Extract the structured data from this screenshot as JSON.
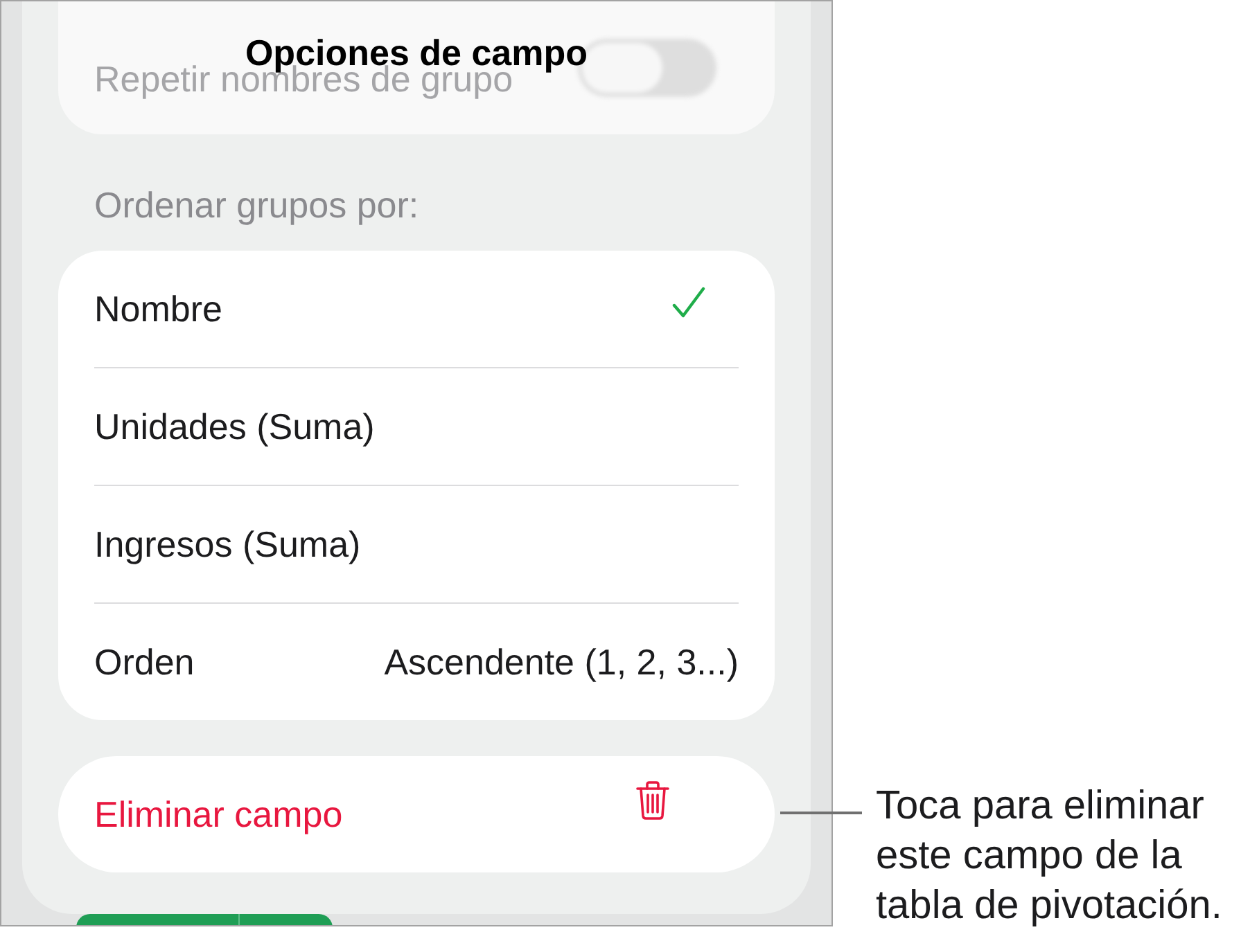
{
  "sheet": {
    "title": "Opciones de campo"
  },
  "background_row": {
    "label": "Repetir nombres de grupo",
    "toggle": {
      "on": false
    }
  },
  "sort_section": {
    "heading": "Ordenar grupos por:",
    "options": [
      {
        "label": "Nombre",
        "selected": true
      },
      {
        "label": "Unidades (Suma)",
        "selected": false
      },
      {
        "label": "Ingresos (Suma)",
        "selected": false
      }
    ],
    "order": {
      "label": "Orden",
      "value": "Ascendente (1, 2, 3...)"
    }
  },
  "delete_button": {
    "label": "Eliminar campo"
  },
  "callout": {
    "lines": [
      "Toca para eliminar",
      "este campo de la",
      "tabla de pivotación."
    ]
  }
}
